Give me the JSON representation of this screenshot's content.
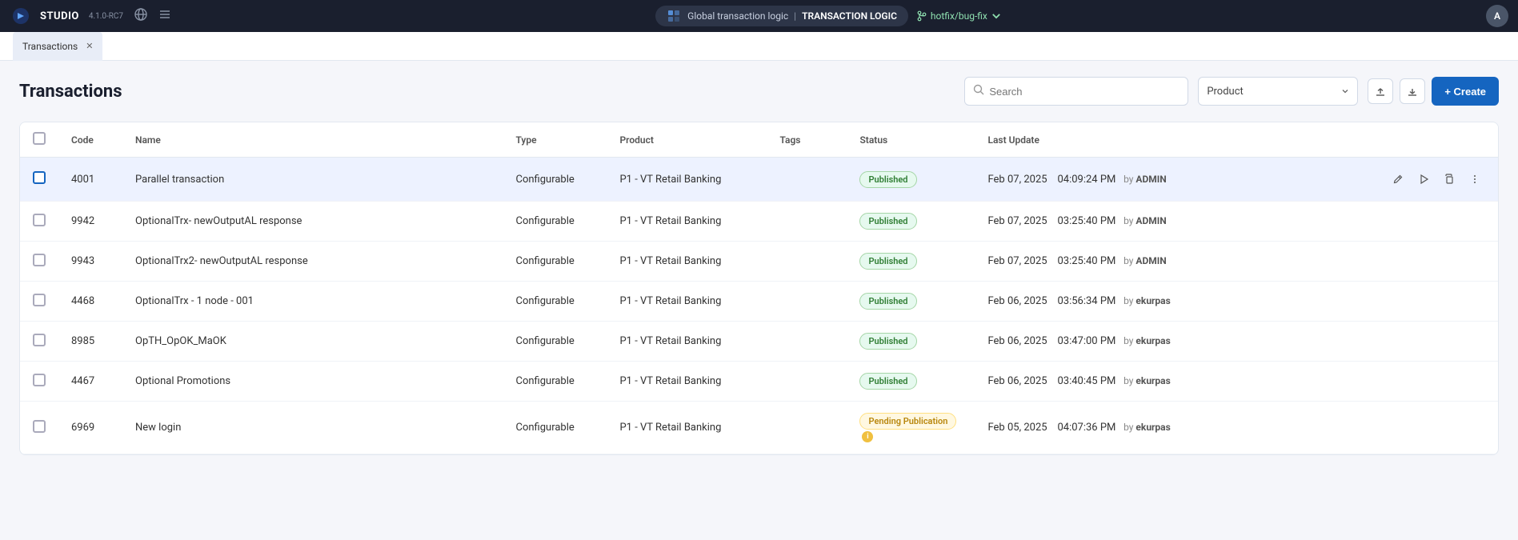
{
  "app": {
    "name": "STUDIO",
    "version": "4.1.0-RC7"
  },
  "nav": {
    "project_name": "Global transaction logic",
    "project_section": "TRANSACTION LOGIC",
    "branch": "hotfix/bug-fix",
    "user_initial": "A"
  },
  "tabs": [
    {
      "label": "Transactions",
      "active": true
    }
  ],
  "page": {
    "title": "Transactions",
    "search_placeholder": "Search",
    "product_dropdown_label": "Product",
    "create_label": "+ Create"
  },
  "table": {
    "columns": [
      "Code",
      "Name",
      "Type",
      "Product",
      "Tags",
      "Status",
      "Last Update"
    ],
    "rows": [
      {
        "code": "4001",
        "name": "Parallel transaction",
        "type": "Configurable",
        "product": "P1 - VT Retail Banking",
        "tags": "",
        "status": "Published",
        "status_type": "published",
        "date": "Feb 07, 2025",
        "time": "04:09:24 PM",
        "by": "ADMIN",
        "selected": true
      },
      {
        "code": "9942",
        "name": "OptionalTrx- newOutputAL response",
        "type": "Configurable",
        "product": "P1 - VT Retail Banking",
        "tags": "",
        "status": "Published",
        "status_type": "published",
        "date": "Feb 07, 2025",
        "time": "03:25:40 PM",
        "by": "ADMIN",
        "selected": false
      },
      {
        "code": "9943",
        "name": "OptionalTrx2- newOutputAL response",
        "type": "Configurable",
        "product": "P1 - VT Retail Banking",
        "tags": "",
        "status": "Published",
        "status_type": "published",
        "date": "Feb 07, 2025",
        "time": "03:25:40 PM",
        "by": "ADMIN",
        "selected": false
      },
      {
        "code": "4468",
        "name": "OptionalTrx - 1 node - 001",
        "type": "Configurable",
        "product": "P1 - VT Retail Banking",
        "tags": "",
        "status": "Published",
        "status_type": "published",
        "date": "Feb 06, 2025",
        "time": "03:56:34 PM",
        "by": "ekurpas",
        "selected": false
      },
      {
        "code": "8985",
        "name": "OpTH_OpOK_MaOK",
        "type": "Configurable",
        "product": "P1 - VT Retail Banking",
        "tags": "",
        "status": "Published",
        "status_type": "published",
        "date": "Feb 06, 2025",
        "time": "03:47:00 PM",
        "by": "ekurpas",
        "selected": false
      },
      {
        "code": "4467",
        "name": "Optional Promotions",
        "type": "Configurable",
        "product": "P1 - VT Retail Banking",
        "tags": "",
        "status": "Published",
        "status_type": "published",
        "date": "Feb 06, 2025",
        "time": "03:40:45 PM",
        "by": "ekurpas",
        "selected": false
      },
      {
        "code": "6969",
        "name": "New login",
        "type": "Configurable",
        "product": "P1 - VT Retail Banking",
        "tags": "",
        "status": "Pending Publication",
        "status_type": "pending",
        "date": "Feb 05, 2025",
        "time": "04:07:36 PM",
        "by": "ekurpas",
        "selected": false
      }
    ]
  }
}
